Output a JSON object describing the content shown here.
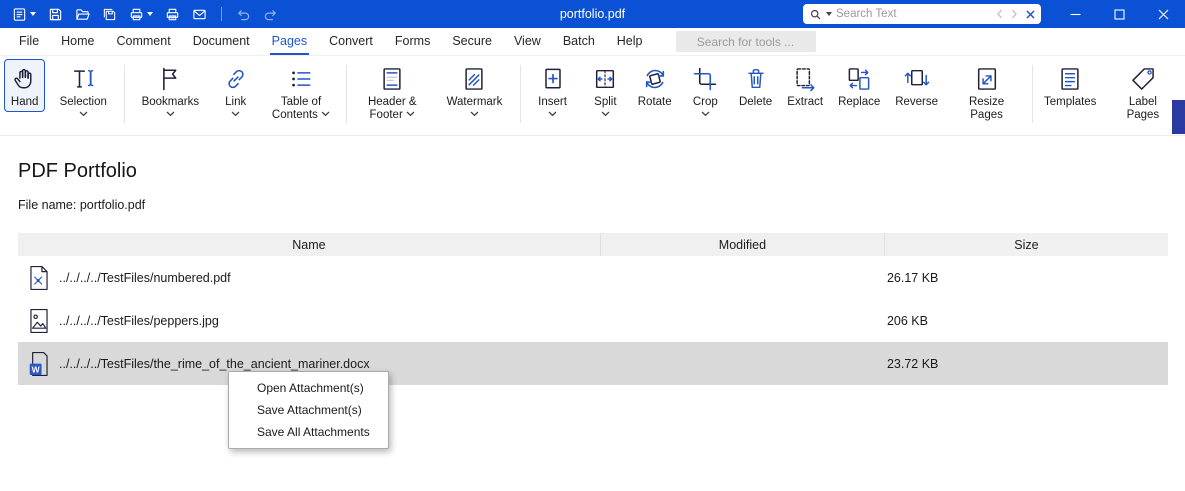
{
  "titlebar": {
    "title": "portfolio.pdf",
    "search_placeholder": "Search Text",
    "quick_access": [
      {
        "name": "app-menu",
        "caret": true
      },
      {
        "name": "save"
      },
      {
        "name": "open"
      },
      {
        "name": "save-all"
      },
      {
        "name": "print",
        "caret": true
      },
      {
        "name": "quick-print"
      },
      {
        "name": "email"
      },
      {
        "name": "sep"
      },
      {
        "name": "undo",
        "disabled": true
      },
      {
        "name": "redo",
        "disabled": true
      }
    ],
    "window_controls": [
      "minimize",
      "maximize",
      "close"
    ]
  },
  "menubar": {
    "items": [
      "File",
      "Home",
      "Comment",
      "Document",
      "Pages",
      "Convert",
      "Forms",
      "Secure",
      "View",
      "Batch",
      "Help"
    ],
    "active": "Pages",
    "tool_search_placeholder": "Search for tools ..."
  },
  "ribbon": {
    "tools": [
      {
        "label": "Hand",
        "icon": "hand-icon",
        "dropdown": false,
        "active": true
      },
      {
        "label": "Selection",
        "icon": "selection-icon",
        "dropdown": true,
        "sep_after": true
      },
      {
        "label": "Bookmarks",
        "icon": "bookmarks-icon",
        "dropdown": true
      },
      {
        "label": "Link",
        "icon": "link-icon",
        "dropdown": true
      },
      {
        "label": "Table of Contents",
        "icon": "toc-icon",
        "dropdown": true,
        "sep_after": true
      },
      {
        "label": "Header & Footer",
        "icon": "header-footer-icon",
        "dropdown": true
      },
      {
        "label": "Watermark",
        "icon": "watermark-icon",
        "dropdown": true,
        "sep_after": true
      },
      {
        "label": "Insert",
        "icon": "insert-icon",
        "dropdown": true
      },
      {
        "label": "Split",
        "icon": "split-icon",
        "dropdown": true
      },
      {
        "label": "Rotate",
        "icon": "rotate-icon",
        "dropdown": false
      },
      {
        "label": "Crop",
        "icon": "crop-icon",
        "dropdown": true
      },
      {
        "label": "Delete",
        "icon": "delete-icon",
        "dropdown": false
      },
      {
        "label": "Extract",
        "icon": "extract-icon",
        "dropdown": false
      },
      {
        "label": "Replace",
        "icon": "replace-icon",
        "dropdown": false
      },
      {
        "label": "Reverse",
        "icon": "reverse-icon",
        "dropdown": false
      },
      {
        "label": "Resize Pages",
        "icon": "resize-pages-icon",
        "dropdown": false,
        "sep_after": true
      },
      {
        "label": "Templates",
        "icon": "templates-icon",
        "dropdown": false
      },
      {
        "label": "Label Pages",
        "icon": "label-pages-icon",
        "dropdown": false
      }
    ]
  },
  "portfolio": {
    "title": "PDF Portfolio",
    "file_name_label": "File name: portfolio.pdf",
    "table": {
      "columns": [
        "Name",
        "Modified",
        "Size"
      ],
      "rows": [
        {
          "icon": "pdf-file-icon",
          "name": "../../../../TestFiles/numbered.pdf",
          "modified": "",
          "size": "26.17 KB",
          "selected": false
        },
        {
          "icon": "image-file-icon",
          "name": "../../../../TestFiles/peppers.jpg",
          "modified": "",
          "size": "206 KB",
          "selected": false
        },
        {
          "icon": "word-file-icon",
          "name": "../../../../TestFiles/the_rime_of_the_ancient_mariner.docx",
          "modified": "",
          "size": "23.72 KB",
          "selected": true
        }
      ]
    }
  },
  "context_menu": {
    "items": [
      "Open Attachment(s)",
      "Save Attachment(s)",
      "Save All Attachments"
    ]
  },
  "colors": {
    "titlebar": "#0b51d6",
    "accent": "#1d55d3",
    "selected_row": "#d9d9d9",
    "panel_handle": "#2b3aa0",
    "table_header_bg": "#f0f0f0"
  }
}
